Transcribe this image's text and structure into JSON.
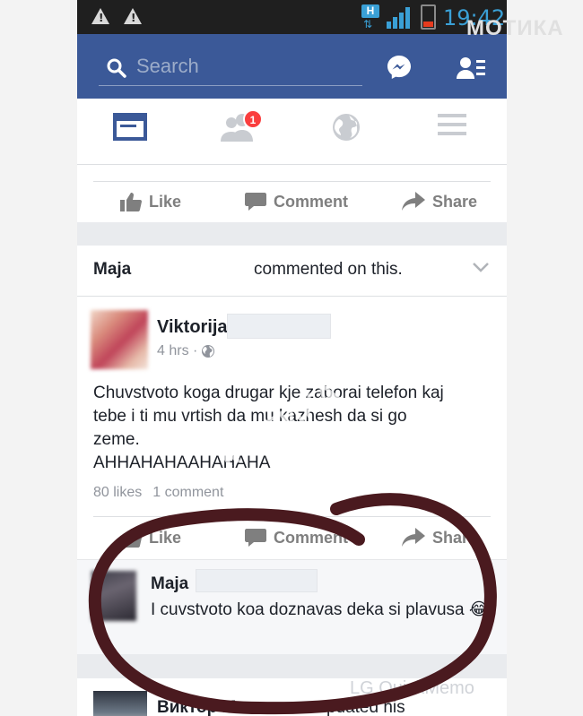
{
  "status_bar": {
    "time": "19:42",
    "network_label": "H"
  },
  "header": {
    "search_placeholder": "Search"
  },
  "tabs": {
    "friend_requests_badge": "1"
  },
  "actions": {
    "like": "Like",
    "comment": "Comment",
    "share": "Share"
  },
  "story": {
    "actor": "Maja",
    "action": "commented on this.",
    "post": {
      "author": "Viktorija",
      "time": "4 hrs ·",
      "text_lines": [
        "Chuvstvoto koga drugar kje zaborai telefon kaj",
        "tebe i ti mu vrtish da mu kazhesh da si go",
        "zeme.",
        "AHHAHAHAAHAHAHA"
      ],
      "likes": "80 likes",
      "comments": "1 comment"
    },
    "comment": {
      "author": "Maja",
      "text": "I cuvstvoto koa  doznavas deka si plavusa 😂"
    }
  },
  "next_story": {
    "author": "Виктор Митковски",
    "action": "updated his"
  },
  "watermarks": {
    "top": "МОТИКА",
    "center": "МОТИКА",
    "bottom": "LG QuickMemo"
  },
  "colors": {
    "facebook_blue": "#3b5998",
    "annotation_ink": "#4a1a1f",
    "status_accent": "#3aa0d6",
    "badge_red": "#fa3e3e"
  }
}
